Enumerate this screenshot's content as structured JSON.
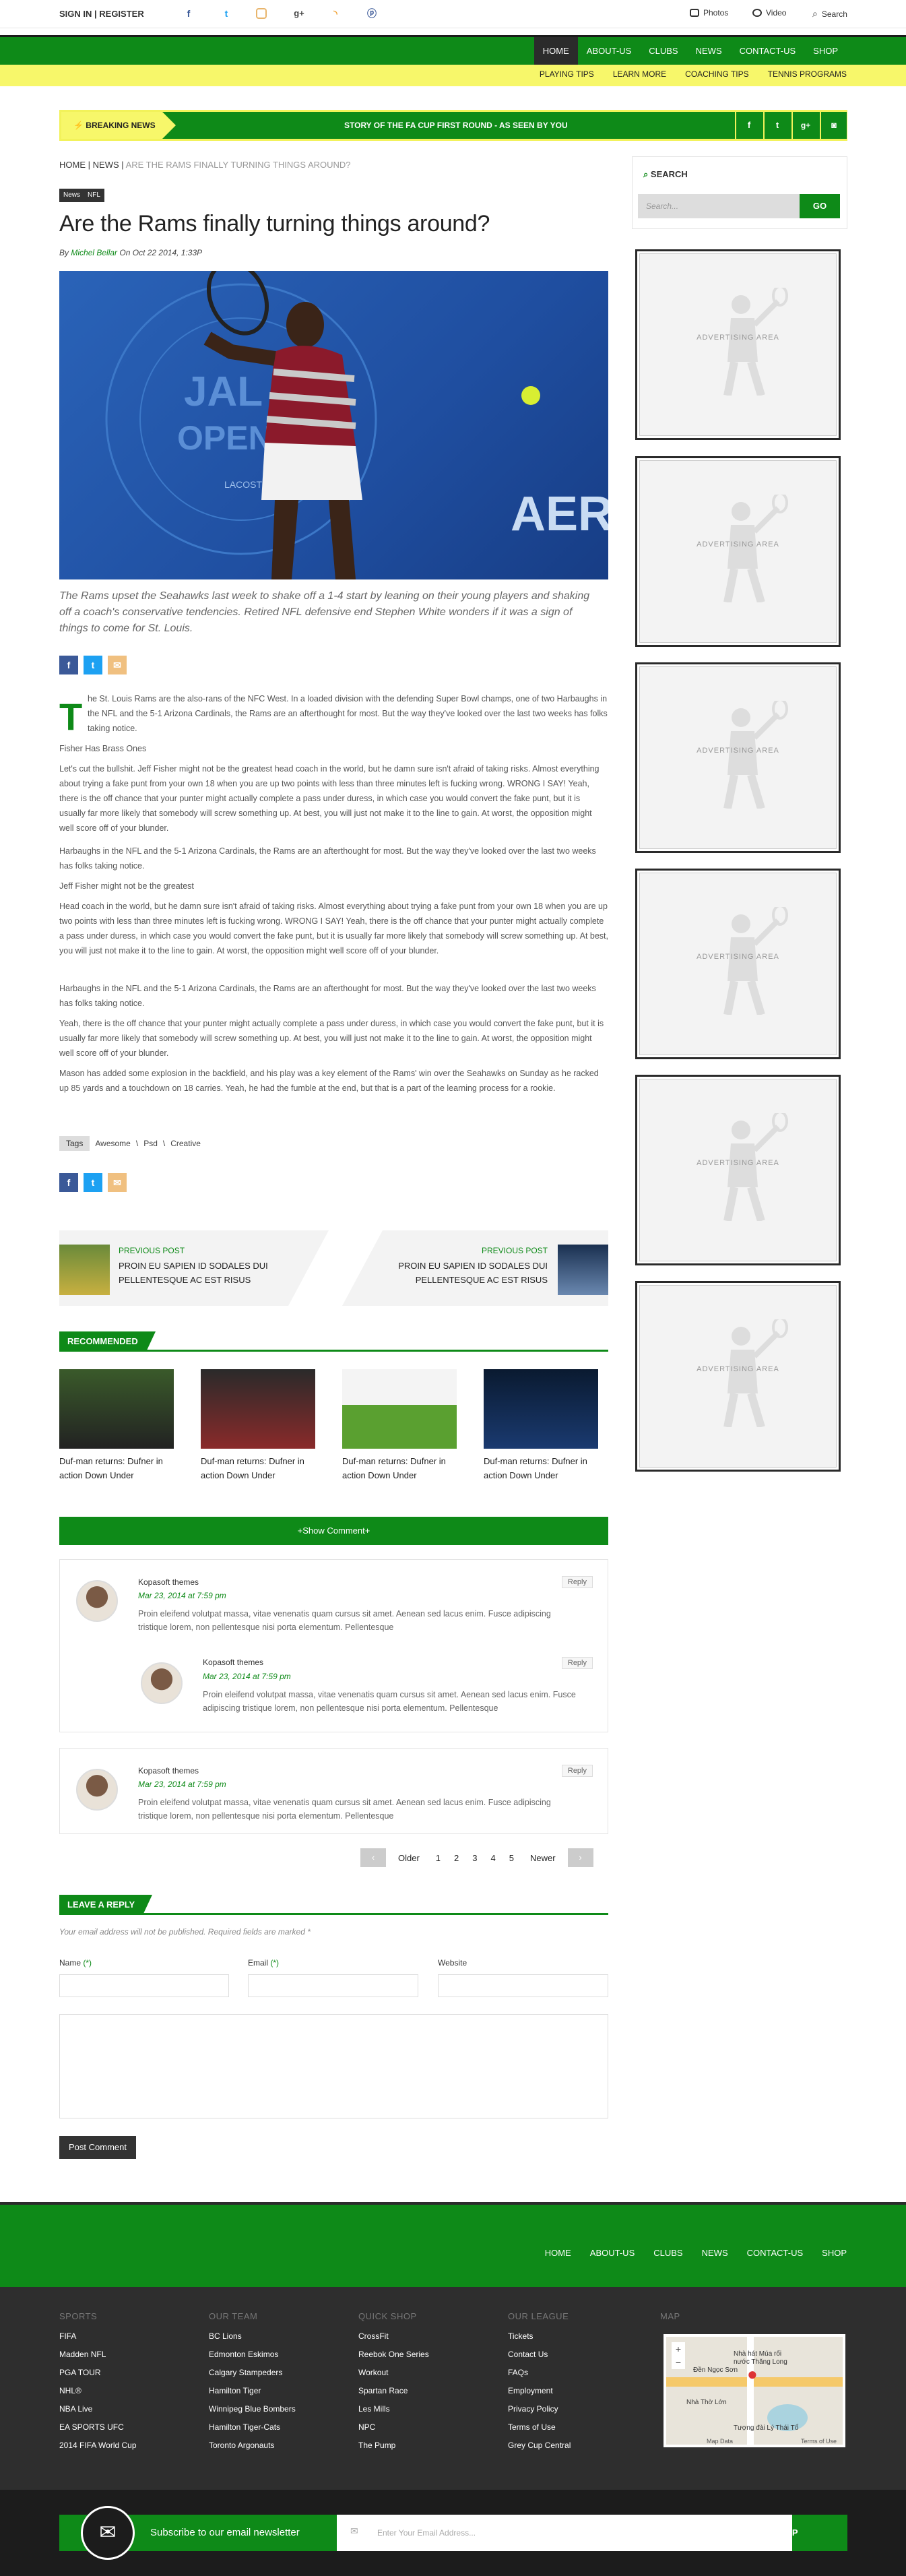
{
  "topbar": {
    "sign": "SIGN IN | REGISTER",
    "photos": "Photos",
    "video": "Video",
    "search": "Search"
  },
  "nav": [
    "HOME",
    "ABOUT-US",
    "CLUBS",
    "NEWS",
    "CONTACT-US",
    "SHOP"
  ],
  "subnav": [
    "PLAYING TIPS",
    "LEARN MORE",
    "COACHING TIPS",
    "TENNIS PROGRAMS"
  ],
  "breaking": {
    "label": "BREAKING NEWS",
    "text": "STORY OF THE FA CUP FIRST ROUND - AS SEEN BY YOU"
  },
  "breadcrumb": {
    "home": "HOME",
    "sep1": "|",
    "news": "NEWS",
    "sep2": "|",
    "current": "ARE THE RAMS FINALLY TURNING THINGS AROUND?"
  },
  "tags_top": [
    "News",
    "NFL"
  ],
  "article": {
    "title": "Are the Rams finally turning things around?",
    "by": "By",
    "author": "Michel Bellar",
    "date": "On Oct 22 2014, 1:33P",
    "lede": "The Rams upset the Seahawks last week to shake off a 1-4 start by leaning on their young players and shaking off a coach's conservative tendencies. Retired NFL defensive end Stephen White wonders if it was a sign of things to come for St. Louis.",
    "dropcap": "T",
    "p1": "he St. Louis Rams are the also-rans of the NFC West. In a loaded division with the defending Super Bowl champs, one of two Harbaughs in the NFL and the 5-1 Arizona Cardinals, the Rams are an afterthought for most. But the way they've looked over the last two weeks has folks taking notice.",
    "p2": "Fisher Has Brass Ones",
    "p3": "Let's cut the bullshit. Jeff Fisher might not be the greatest head coach in the world, but he damn sure isn't afraid of taking risks. Almost everything about trying a fake punt from your own 18 when you are up two points with less than three minutes left is fucking wrong. WRONG I SAY! Yeah, there is the off chance that your punter might actually complete a pass under duress, in which case you would convert the fake punt, but it is usually far more likely that somebody will screw something up. At best, you will just not make it to the line to gain. At worst, the opposition might well score off of your blunder.",
    "p4": "Harbaughs in the NFL and the 5-1 Arizona Cardinals, the Rams are an afterthought for most. But the way they've looked over the last two weeks has folks taking notice.",
    "p5": "Jeff Fisher might not be the greatest",
    "p6": "Head coach in the world, but he damn sure isn't afraid of taking risks. Almost everything about trying a fake punt from your own 18 when you are up two points with less than three minutes left is fucking wrong. WRONG I SAY! Yeah, there is the off chance that your punter might actually complete a pass under duress, in which case you would convert the fake punt, but it is usually far more likely that somebody will screw something up. At best, you will just not make it to the line to gain. At worst, the opposition might well score off of your blunder.",
    "p7": "Harbaughs in the NFL and the 5-1 Arizona Cardinals, the Rams are an afterthought for most. But the way they've looked over the last two weeks has folks taking notice.",
    "p8": "Yeah, there is the off chance that your punter might actually complete a pass under duress, in which case you would convert the fake punt, but it is usually far more likely that somebody will screw something up. At best, you will just not make it to the line to gain. At worst, the opposition might well score off of your blunder.",
    "p9": "Mason has added some explosion in the backfield, and his play was a key element of the Rams' win over the Seahawks on Sunday as he racked up 85 yards and a touchdown on 18 carries. Yeah, he had the fumble at the end, but that is a part of the learning process for a rookie."
  },
  "hero_text": {
    "logo": "AER",
    "jal": "JAL",
    "open": "OPEN",
    "lacoste": "LACOSTE"
  },
  "tags": {
    "label": "Tags",
    "items": [
      "Awesome",
      "\\",
      "Psd",
      "\\",
      "Creative"
    ]
  },
  "prevnext": {
    "prev_label": "PREVIOUS POST",
    "prev_title": "PROIN EU SAPIEN ID SODALES DUI PELLENTESQUE AC EST RISUS",
    "next_label": "PREVIOUS POST",
    "next_title": "PROIN EU SAPIEN ID SODALES DUI PELLENTESQUE AC EST RISUS"
  },
  "recommended": {
    "heading": "RECOMMENDED",
    "items": [
      "Duf-man returns: Dufner in action Down Under",
      "Duf-man returns: Dufner in action Down Under",
      "Duf-man returns: Dufner in action Down Under",
      "Duf-man returns: Dufner in action Down Under"
    ]
  },
  "show_comment": "+Show Comment+",
  "comments": [
    {
      "name": "Kopasoft themes",
      "date": "Mar 23, 2014 at 7:59 pm",
      "reply": "Reply",
      "text": "Proin eleifend volutpat massa, vitae venenatis quam cursus sit amet. Aenean sed lacus enim. Fusce adipiscing tristique lorem, non pellentesque nisi porta elementum. Pellentesque"
    },
    {
      "name": "Kopasoft themes",
      "date": "Mar 23, 2014 at 7:59 pm",
      "reply": "Reply",
      "text": "Proin eleifend volutpat massa, vitae venenatis quam cursus sit amet. Aenean sed lacus enim. Fusce adipiscing tristique lorem, non pellentesque nisi porta elementum. Pellentesque"
    },
    {
      "name": "Kopasoft themes",
      "date": "Mar 23, 2014 at 7:59 pm",
      "reply": "Reply",
      "text": "Proin eleifend volutpat massa, vitae venenatis quam cursus sit amet. Aenean sed lacus enim. Fusce adipiscing tristique lorem, non pellentesque nisi porta elementum. Pellentesque"
    }
  ],
  "pagination": {
    "older": "Older",
    "pages": [
      "1",
      "2",
      "3",
      "4",
      "5"
    ],
    "newer": "Newer"
  },
  "reply_form": {
    "heading": "LEAVE A REPLY",
    "note": "Your email address will not be published. Required fields are marked *",
    "name": "Name",
    "email": "Email",
    "website": "Website",
    "req": "(*)",
    "submit": "Post Comment"
  },
  "sidebar": {
    "search_heading": "SEARCH",
    "search_placeholder": "Search...",
    "go": "GO",
    "ad_text": "ADVERTISING AREA"
  },
  "footer": {
    "nav": [
      "HOME",
      "ABOUT-US",
      "CLUBS",
      "NEWS",
      "CONTACT-US",
      "SHOP"
    ],
    "cols": [
      {
        "h": "SPORTS",
        "items": [
          "FIFA",
          "Madden NFL",
          "PGA TOUR",
          "NHL®",
          "NBA Live",
          "EA SPORTS UFC",
          "2014 FIFA World Cup"
        ]
      },
      {
        "h": "OUR TEAM",
        "items": [
          "BC Lions",
          "Edmonton Eskimos",
          "Calgary Stampeders",
          "Hamilton Tiger",
          "Winnipeg Blue Bombers",
          "Hamilton Tiger-Cats",
          "Toronto Argonauts"
        ]
      },
      {
        "h": "QUICK SHOP",
        "items": [
          "CrossFit",
          "Reebok One Series",
          "Workout",
          "Spartan Race",
          "Les Mills",
          "NPC",
          "The Pump"
        ]
      },
      {
        "h": "OUR LEAGUE",
        "items": [
          "Tickets",
          "Contact Us",
          "FAQs",
          "Employment",
          "Privacy Policy",
          "Terms of Use",
          "Grey Cup Central"
        ]
      }
    ],
    "map_heading": "MAP",
    "map": {
      "l1": "Nhà hát Múa rối",
      "l2": "nước Thăng Long",
      "l3": "Đền Ngọc Sơn",
      "l4": "Nhà Thờ Lớn",
      "l5": "Tượng đài Lý Thái Tổ",
      "data": "Map Data",
      "terms": "Terms of Use"
    },
    "newsletter": {
      "text": "Subscribe to our email newsletter",
      "placeholder": "Enter Your Email Address...",
      "button": "SIGN ME UP"
    }
  }
}
